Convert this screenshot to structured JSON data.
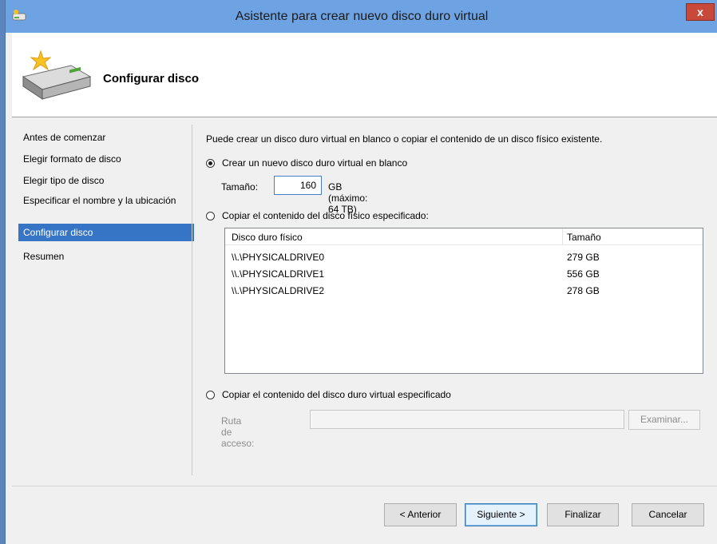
{
  "window": {
    "title": "Asistente para crear nuevo disco duro virtual",
    "close_glyph": "x"
  },
  "header": {
    "title": "Configurar disco",
    "icon": "virtual-disk-icon"
  },
  "nav": {
    "items": [
      {
        "label": "Antes de comenzar",
        "active": false
      },
      {
        "label": "Elegir formato de disco",
        "active": false
      },
      {
        "label": "Elegir tipo de disco",
        "active": false
      },
      {
        "label": "Especificar el nombre y la ubicación",
        "active": false
      },
      {
        "label": "Configurar disco",
        "active": true
      },
      {
        "label": "Resumen",
        "active": false
      }
    ]
  },
  "content": {
    "intro": "Puede crear un disco duro virtual en blanco o copiar el contenido de un disco físico existente.",
    "option_new": {
      "label": "Crear un nuevo disco duro virtual en blanco",
      "checked": true
    },
    "size": {
      "label": "Tamaño:",
      "value": "160",
      "hint": "GB (máximo: 64 TB)"
    },
    "option_physical": {
      "label": "Copiar el contenido del disco físico especificado:",
      "checked": false
    },
    "physical_table": {
      "columns": [
        "Disco duro físico",
        "Tamaño"
      ],
      "rows": [
        {
          "disk": "\\\\.\\PHYSICALDRIVE0",
          "size": "279 GB"
        },
        {
          "disk": "\\\\.\\PHYSICALDRIVE1",
          "size": "556 GB"
        },
        {
          "disk": "\\\\.\\PHYSICALDRIVE2",
          "size": "278 GB"
        }
      ]
    },
    "option_virtual": {
      "label": "Copiar el contenido del disco duro virtual especificado",
      "checked": false
    },
    "path": {
      "label": "Ruta de acceso:",
      "value": ""
    },
    "browse_label": "Examinar..."
  },
  "footer": {
    "previous": "< Anterior",
    "next": "Siguiente >",
    "finish": "Finalizar",
    "cancel": "Cancelar"
  },
  "colors": {
    "titlebar": "#6ea3e3",
    "close": "#c8493a",
    "selection": "#3675c5"
  }
}
